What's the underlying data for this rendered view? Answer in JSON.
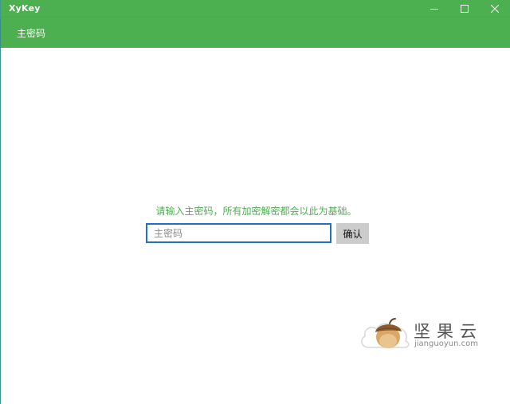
{
  "window": {
    "title": "XyKey",
    "controls": [
      "minimize",
      "maximize",
      "close"
    ]
  },
  "tabs": [
    {
      "label": "主密码",
      "active": true
    }
  ],
  "main": {
    "prompt": "请输入主密码，所有加密解密都会以此为基础。",
    "password_input": {
      "placeholder": "主密码",
      "value": ""
    },
    "confirm_label": "确认"
  },
  "watermark": {
    "name": "坚果云",
    "url": "jianguoyun.com"
  },
  "colors": {
    "accent": "#4caf50",
    "input_border": "#1e72c0",
    "button_bg": "#cccccc",
    "prompt_text": "#4caf50"
  },
  "icons": {
    "minimize": "minimize-icon",
    "maximize": "maximize-icon",
    "close": "close-icon",
    "watermark_logo": "acorn-cloud-logo"
  }
}
